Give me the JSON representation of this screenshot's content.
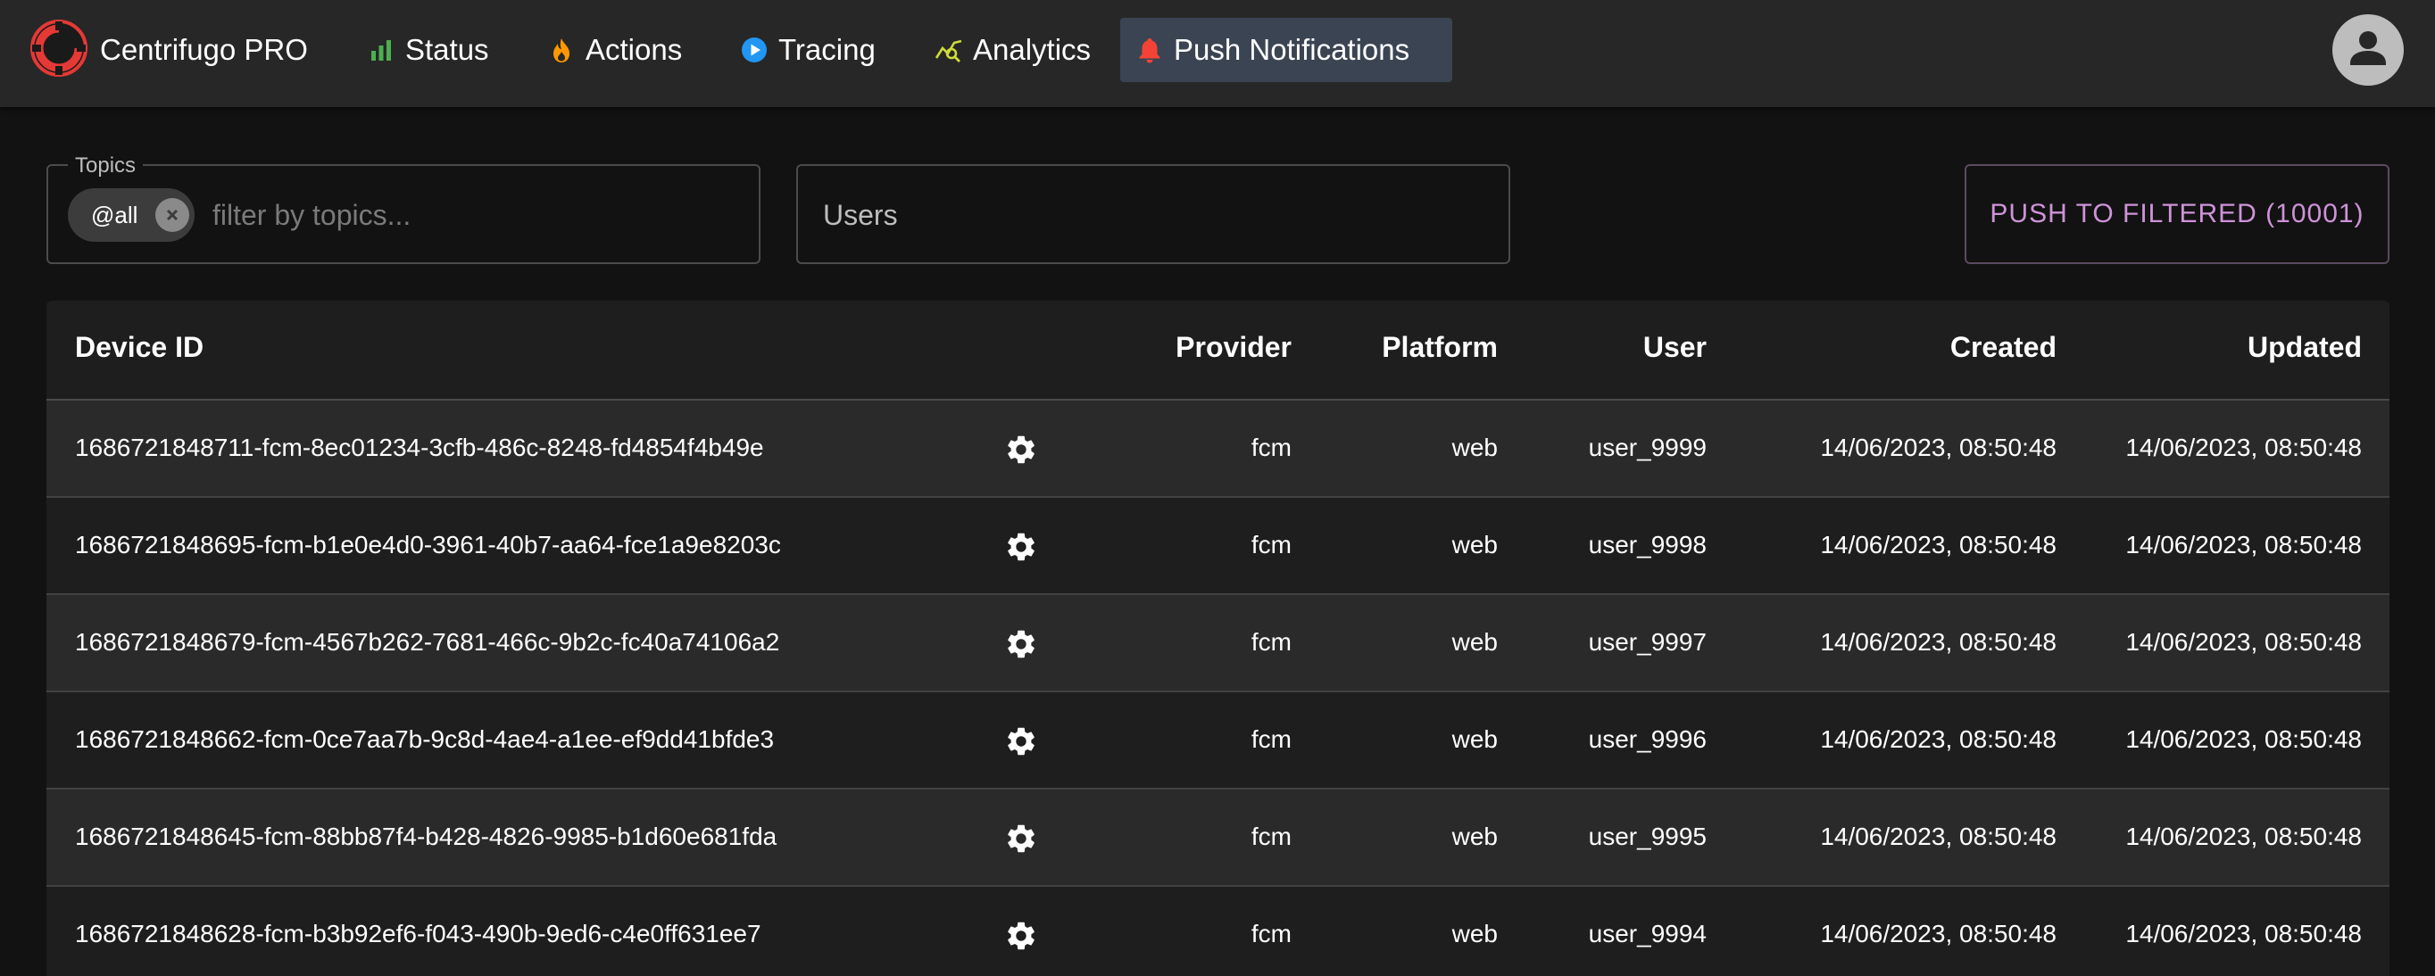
{
  "app": {
    "title": "Centrifugo PRO"
  },
  "nav": {
    "items": [
      {
        "label": "Status",
        "icon": "bar-chart-icon"
      },
      {
        "label": "Actions",
        "icon": "flame-icon"
      },
      {
        "label": "Tracing",
        "icon": "play-circle-icon"
      },
      {
        "label": "Analytics",
        "icon": "query-stats-icon"
      },
      {
        "label": "Push Notifications",
        "icon": "bell-icon",
        "active": true
      }
    ]
  },
  "filters": {
    "topics": {
      "legend": "Topics",
      "chip": "@all",
      "placeholder": "filter by topics..."
    },
    "users": {
      "placeholder": "Users"
    },
    "push_button": "PUSH TO FILTERED (10001)"
  },
  "table": {
    "columns": {
      "device_id": "Device ID",
      "provider": "Provider",
      "platform": "Platform",
      "user": "User",
      "created": "Created",
      "updated": "Updated"
    },
    "rows": [
      {
        "device_id": "1686721848711-fcm-8ec01234-3cfb-486c-8248-fd4854f4b49e",
        "provider": "fcm",
        "platform": "web",
        "user": "user_9999",
        "created": "14/06/2023, 08:50:48",
        "updated": "14/06/2023, 08:50:48"
      },
      {
        "device_id": "1686721848695-fcm-b1e0e4d0-3961-40b7-aa64-fce1a9e8203c",
        "provider": "fcm",
        "platform": "web",
        "user": "user_9998",
        "created": "14/06/2023, 08:50:48",
        "updated": "14/06/2023, 08:50:48"
      },
      {
        "device_id": "1686721848679-fcm-4567b262-7681-466c-9b2c-fc40a74106a2",
        "provider": "fcm",
        "platform": "web",
        "user": "user_9997",
        "created": "14/06/2023, 08:50:48",
        "updated": "14/06/2023, 08:50:48"
      },
      {
        "device_id": "1686721848662-fcm-0ce7aa7b-9c8d-4ae4-a1ee-ef9dd41bfde3",
        "provider": "fcm",
        "platform": "web",
        "user": "user_9996",
        "created": "14/06/2023, 08:50:48",
        "updated": "14/06/2023, 08:50:48"
      },
      {
        "device_id": "1686721848645-fcm-88bb87f4-b428-4826-9985-b1d60e681fda",
        "provider": "fcm",
        "platform": "web",
        "user": "user_9995",
        "created": "14/06/2023, 08:50:48",
        "updated": "14/06/2023, 08:50:48"
      },
      {
        "device_id": "1686721848628-fcm-b3b92ef6-f043-490b-9ed6-c4e0ff631ee7",
        "provider": "fcm",
        "platform": "web",
        "user": "user_9994",
        "created": "14/06/2023, 08:50:48",
        "updated": "14/06/2023, 08:50:48"
      }
    ]
  },
  "colors": {
    "accent_purple": "#ce93d8",
    "active_nav_bg": "#3b4452",
    "status_green": "#4caf50",
    "actions_orange": "#ff9800",
    "tracing_blue": "#2196f3",
    "analytics_yellow_green": "#cddc39",
    "bell_red": "#f44336",
    "logo_red": "#e53935"
  }
}
